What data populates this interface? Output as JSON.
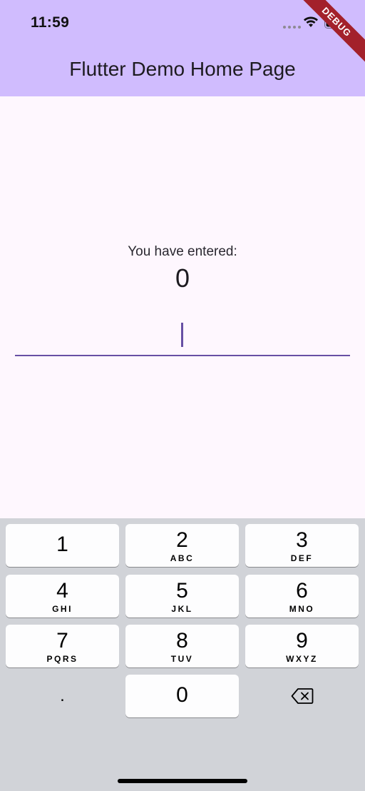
{
  "status_bar": {
    "time": "11:59",
    "debug_banner": "DEBUG"
  },
  "app_bar": {
    "title": "Flutter Demo Home Page"
  },
  "content": {
    "label": "You have entered:",
    "value": "0"
  },
  "keypad": {
    "keys": [
      {
        "digit": "1",
        "letters": ""
      },
      {
        "digit": "2",
        "letters": "ABC"
      },
      {
        "digit": "3",
        "letters": "DEF"
      },
      {
        "digit": "4",
        "letters": "GHI"
      },
      {
        "digit": "5",
        "letters": "JKL"
      },
      {
        "digit": "6",
        "letters": "MNO"
      },
      {
        "digit": "7",
        "letters": "PQRS"
      },
      {
        "digit": "8",
        "letters": "TUV"
      },
      {
        "digit": "9",
        "letters": "WXYZ"
      }
    ],
    "decimal_key": ".",
    "zero_key": "0",
    "backspace_icon": "backspace-icon"
  },
  "colors": {
    "app_bar": "#d0bcfe",
    "background": "#fef7fe",
    "accent": "#6750a4",
    "keyboard": "#d1d3d8",
    "debug_ribbon": "#a3212b"
  }
}
